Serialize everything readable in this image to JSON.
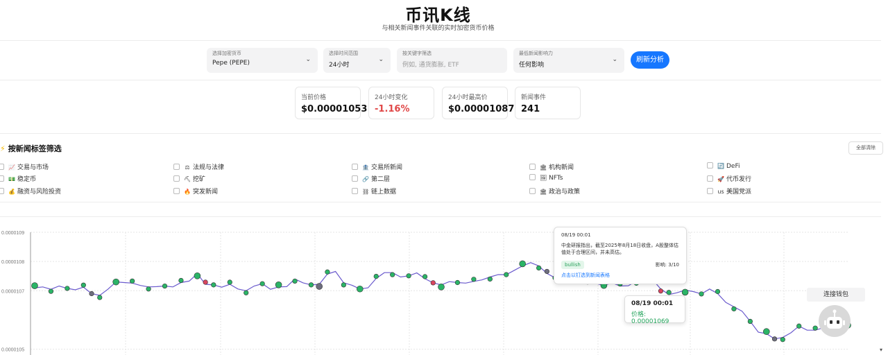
{
  "header": {
    "title": "币讯K线",
    "subtitle": "与相关新闻事件关联的实时加密货币价格"
  },
  "controls": {
    "coin": {
      "label": "选择加密货币",
      "value": "Pepe (PEPE)"
    },
    "range": {
      "label": "选择时间范围",
      "value": "24小时"
    },
    "keyword": {
      "label": "按关键字筛选",
      "placeholder": "例如, 通货膨胀, ETF"
    },
    "impact": {
      "label": "最低新闻影响力",
      "value": "任何影响"
    },
    "refresh_label": "刷新分析"
  },
  "stats": [
    {
      "label": "当前价格",
      "value": "$0.00001053"
    },
    {
      "label": "24小时变化",
      "value": "-1.16%"
    },
    {
      "label": "24小时最高价",
      "value": "$0.00001087"
    },
    {
      "label": "新闻事件",
      "value": "241"
    }
  ],
  "filters": {
    "title": "按新闻标签筛选",
    "clear_label": "全部清除",
    "tags": [
      {
        "icon": "📈",
        "icon_name": "chart-up-icon",
        "label": "交易与市场"
      },
      {
        "icon": "⚖",
        "icon_name": "scales-icon",
        "label": "法规与法律"
      },
      {
        "icon": "🏦",
        "icon_name": "exchange-icon",
        "label": "交易所新闻"
      },
      {
        "icon": "🏛",
        "icon_name": "institution-icon",
        "label": "机构新闻"
      },
      {
        "icon": "🔄",
        "icon_name": "defi-icon",
        "label": "DeFi"
      },
      {
        "icon": "💵",
        "icon_name": "dollar-icon",
        "label": "稳定币"
      },
      {
        "icon": "⛏",
        "icon_name": "pickaxe-icon",
        "label": "挖矿"
      },
      {
        "icon": "🔗",
        "icon_name": "link-icon",
        "label": "第二层"
      },
      {
        "icon": "🖼",
        "icon_name": "picture-icon",
        "label": "NFTs"
      },
      {
        "icon": "🚀",
        "icon_name": "rocket-icon",
        "label": "代币发行"
      },
      {
        "icon": "💰",
        "icon_name": "moneybag-icon",
        "label": "融资与风险投资"
      },
      {
        "icon": "🔥",
        "icon_name": "fire-icon",
        "label": "突发新闻"
      },
      {
        "icon": "⛓",
        "icon_name": "chain-icon",
        "label": "链上数据"
      },
      {
        "icon": "🏛",
        "icon_name": "government-icon",
        "label": "政治与政策"
      },
      {
        "icon": "us",
        "icon_name": "us-flag-icon",
        "label": "美国党派"
      }
    ]
  },
  "chart_data": {
    "type": "line",
    "ylim": [
      1.048e-05,
      1.09e-05
    ],
    "y_ticks": [
      "0.0000109",
      "0.0000108",
      "0.0000107",
      "0.0000105"
    ],
    "y_tick_values": [
      1.09e-05,
      1.08e-05,
      1.07e-05,
      1.05e-05
    ],
    "grid": true,
    "line_color": "#6a5acd",
    "series": [
      {
        "x": [
          0,
          1,
          2,
          3,
          4,
          5,
          6,
          7,
          8,
          9,
          10,
          11,
          12,
          13,
          14,
          15,
          16,
          17,
          18,
          19,
          20,
          21,
          22,
          23,
          24,
          25,
          26,
          27,
          28,
          29,
          30,
          31,
          32,
          33,
          34,
          35,
          36,
          37,
          38,
          39,
          40,
          41,
          42,
          43,
          44,
          45,
          46,
          47,
          48,
          49,
          50,
          51,
          52,
          53,
          54,
          55,
          56,
          57,
          58,
          59,
          60,
          61,
          62,
          63,
          64,
          65,
          66,
          67,
          68,
          69,
          70,
          71,
          72,
          73,
          74,
          75,
          76,
          77,
          78,
          79,
          80,
          81,
          82,
          83,
          84,
          85,
          86,
          87,
          88,
          89,
          90,
          91,
          92,
          93,
          94,
          95,
          96,
          97,
          98,
          99,
          100
        ],
        "y": [
          1.071,
          1.0713,
          1.0705,
          1.0716,
          1.0708,
          1.0703,
          1.0712,
          1.069,
          1.0684,
          1.0705,
          1.073,
          1.0728,
          1.0726,
          1.0718,
          1.0713,
          1.0714,
          1.0716,
          1.0713,
          1.0728,
          1.0733,
          1.0758,
          1.0722,
          1.072,
          1.0712,
          1.0722,
          1.0706,
          1.07,
          1.0716,
          1.0724,
          1.0705,
          1.0713,
          1.0714,
          1.074,
          1.0727,
          1.072,
          1.0722,
          1.0757,
          1.0766,
          1.0727,
          1.0719,
          1.0706,
          1.071,
          1.0742,
          1.0762,
          1.0762,
          1.0747,
          1.0751,
          1.0761,
          1.0741,
          1.0727,
          1.072,
          1.0731,
          1.0728,
          1.0726,
          1.0732,
          1.0737,
          1.0747,
          1.0755,
          1.0755,
          1.077,
          1.0785,
          1.0796,
          1.0785,
          1.0759,
          1.0744,
          1.0752,
          1.0751,
          1.0741,
          1.0737,
          1.0725,
          1.0718,
          1.0727,
          1.0716,
          1.0717,
          1.0733,
          1.0729,
          1.0738,
          1.0706,
          1.0687,
          1.0693,
          1.0702,
          1.0697,
          1.0689,
          1.0706,
          1.069,
          1.066,
          1.0645,
          1.063,
          1.0595,
          1.0558,
          1.0553,
          1.0535,
          1.054,
          1.0556,
          1.0579,
          1.0565,
          1.0565,
          1.0573,
          1.0571,
          1.0578,
          1.0582
        ],
        "y_unit_note": "×1e-5"
      }
    ]
  },
  "tooltip_news": {
    "time": "08/19 00:01",
    "text": "中金研报指出，截至2025年8月18日收盘，A股整体估值处于合理区间，并未高估。",
    "sentiment": "bullish",
    "impact": "影响: 3/10",
    "link": "点击以钉选到新闻表格"
  },
  "tooltip_price": {
    "time": "08/19 00:01",
    "price": "价格: 0.00001069"
  },
  "wallet_label": "连接钱包",
  "colors": {
    "accent": "#1677ff",
    "negative": "#e04848",
    "positive": "#22a35a",
    "marker_green": "#2bb467",
    "marker_red": "#d9455f",
    "marker_gray": "#6e6e7e"
  }
}
